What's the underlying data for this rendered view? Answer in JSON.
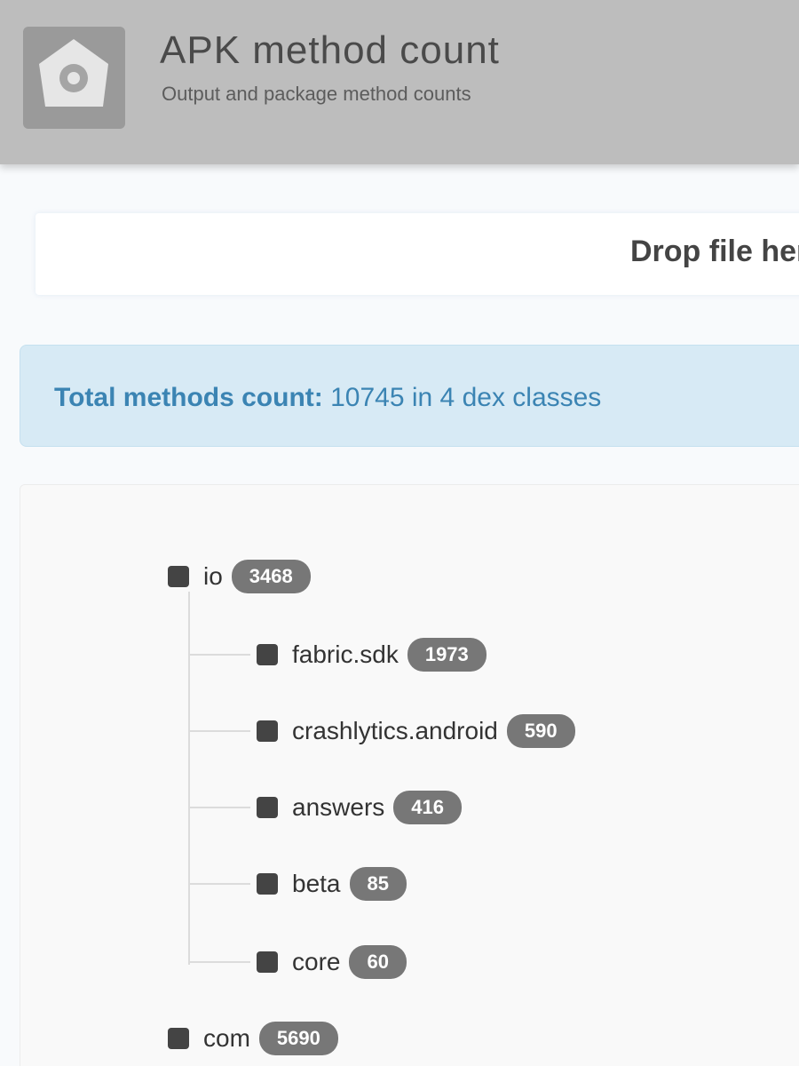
{
  "header": {
    "title": "APK method count",
    "subtitle": "Output and package method counts"
  },
  "drop_zone": {
    "text": "Drop file here"
  },
  "info": {
    "label": "Total methods count:",
    "value": "10745 in 4 dex classes"
  },
  "tree": {
    "root": {
      "label": "io",
      "count": "3468"
    },
    "children": [
      {
        "label": "fabric.sdk",
        "count": "1973"
      },
      {
        "label": "crashlytics.android",
        "count": "590"
      },
      {
        "label": "answers",
        "count": "416"
      },
      {
        "label": "beta",
        "count": "85"
      },
      {
        "label": "core",
        "count": "60"
      }
    ],
    "next": {
      "label": "com",
      "count": "5690"
    }
  },
  "colors": {
    "header_bg": "#bdbdbd",
    "info_bg": "#d7eaf5",
    "info_text": "#3b84b3",
    "badge_bg": "#777777"
  },
  "icons": {
    "logo": "app-logo-icon",
    "tree_node": "square-bullet-icon"
  }
}
